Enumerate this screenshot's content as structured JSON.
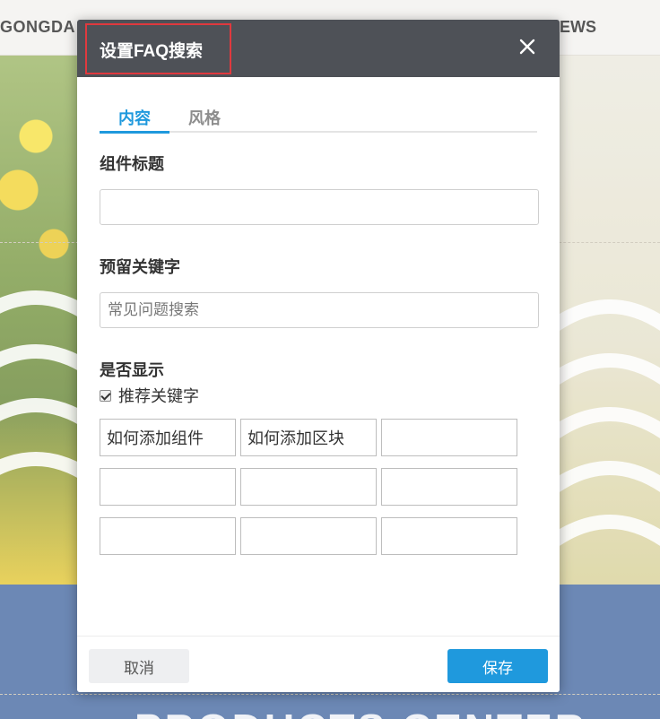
{
  "background": {
    "logo_text": "GONGDA",
    "nav_item": "EWS",
    "banner_text": "PRODUCTS CENTER"
  },
  "dialog": {
    "title": "设置FAQ搜索",
    "close_icon": "close-icon",
    "tabs": [
      {
        "label": "内容",
        "active": true
      },
      {
        "label": "风格",
        "active": false
      }
    ],
    "component_title": {
      "label": "组件标题",
      "value": "",
      "placeholder": ""
    },
    "reserved_keyword": {
      "label": "预留关键字",
      "value": "",
      "placeholder": "常见问题搜索"
    },
    "display": {
      "label": "是否显示",
      "checkbox_label": "推荐关键字",
      "checked": true
    },
    "keywords": [
      [
        "如何添加组件",
        "如何添加区块",
        ""
      ],
      [
        "",
        "",
        ""
      ],
      [
        "",
        "",
        ""
      ]
    ],
    "buttons": {
      "cancel": "取消",
      "save": "保存"
    }
  },
  "colors": {
    "header_bg": "#4e5157",
    "accent": "#1f99dd",
    "highlight_border": "#e0393e"
  }
}
